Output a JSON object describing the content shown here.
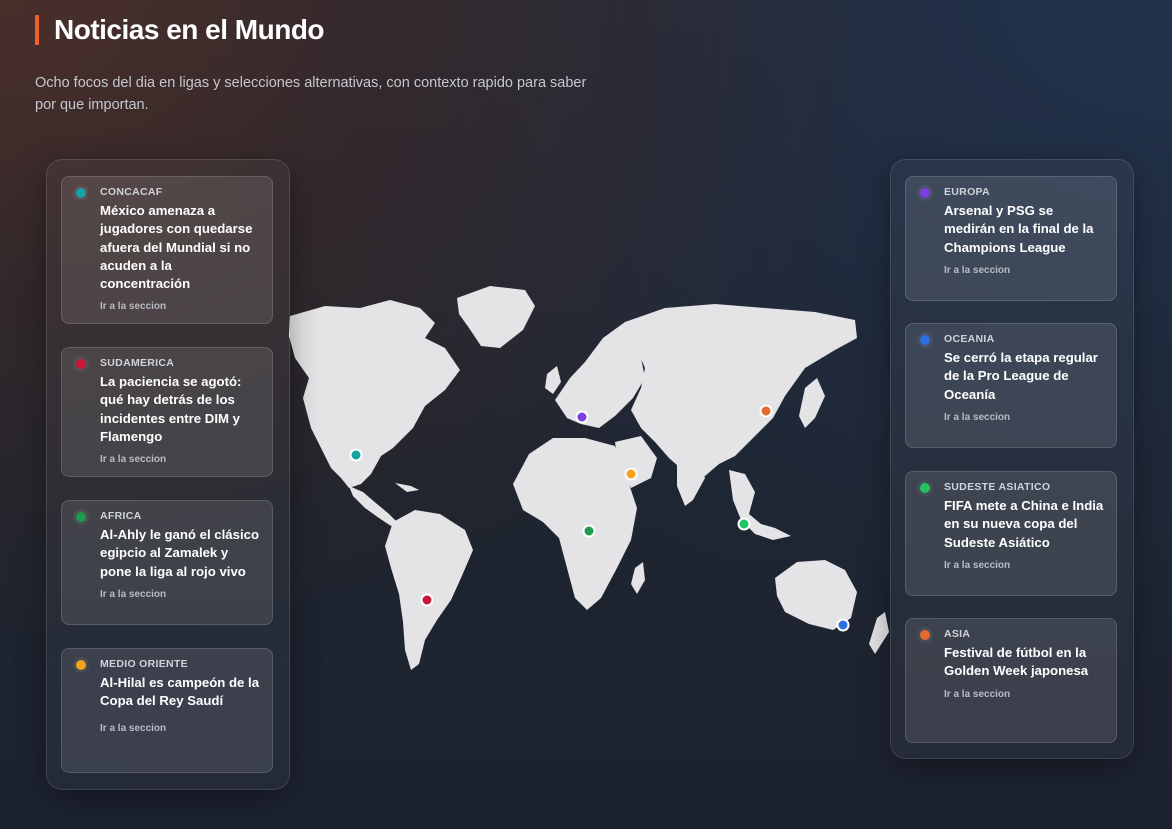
{
  "header": {
    "title": "Noticias en el Mundo",
    "subtitle": "Ocho focos del dia en ligas y selecciones alternativas, con contexto rapido para saber por que importan."
  },
  "colors": {
    "accent": "#f0612a",
    "concacaf": "#14a3a3",
    "sudamerica": "#c8163a",
    "africa": "#1f9a4f",
    "medio_oriente": "#f4a21b",
    "europa": "#7b3fe4",
    "oceania": "#2f6fe6",
    "sudeste_asiatico": "#22c564",
    "asia": "#e8692d"
  },
  "cards_left": [
    {
      "region": "CONCACAF",
      "headline": "México amenaza a jugadores con quedarse afuera del Mundial si no acuden a la concentración",
      "link": "Ir a la seccion"
    },
    {
      "region": "SUDAMERICA",
      "headline": "La paciencia se agotó: qué hay detrás de los incidentes entre DIM y Flamengo",
      "link": "Ir a la seccion"
    },
    {
      "region": "AFRICA",
      "headline": "Al-Ahly le ganó el clásico egipcio al Zamalek y pone la liga al rojo vivo",
      "link": "Ir a la seccion"
    },
    {
      "region": "MEDIO ORIENTE",
      "headline": "Al-Hilal es campeón de la Copa del Rey Saudí",
      "link": "Ir a la seccion"
    }
  ],
  "cards_right": [
    {
      "region": "EUROPA",
      "headline": "Arsenal y PSG se medirán en la final de la Champions League",
      "link": "Ir a la seccion"
    },
    {
      "region": "OCEANIA",
      "headline": "Se cerró la etapa regular de la Pro League de Oceanía",
      "link": "Ir a la seccion"
    },
    {
      "region": "SUDESTE ASIATICO",
      "headline": "FIFA mete a China e India en su nueva copa del Sudeste Asiático",
      "link": "Ir a la seccion"
    },
    {
      "region": "ASIA",
      "headline": "Festival de fútbol en la Golden Week japonesa",
      "link": "Ir a la seccion"
    }
  ]
}
